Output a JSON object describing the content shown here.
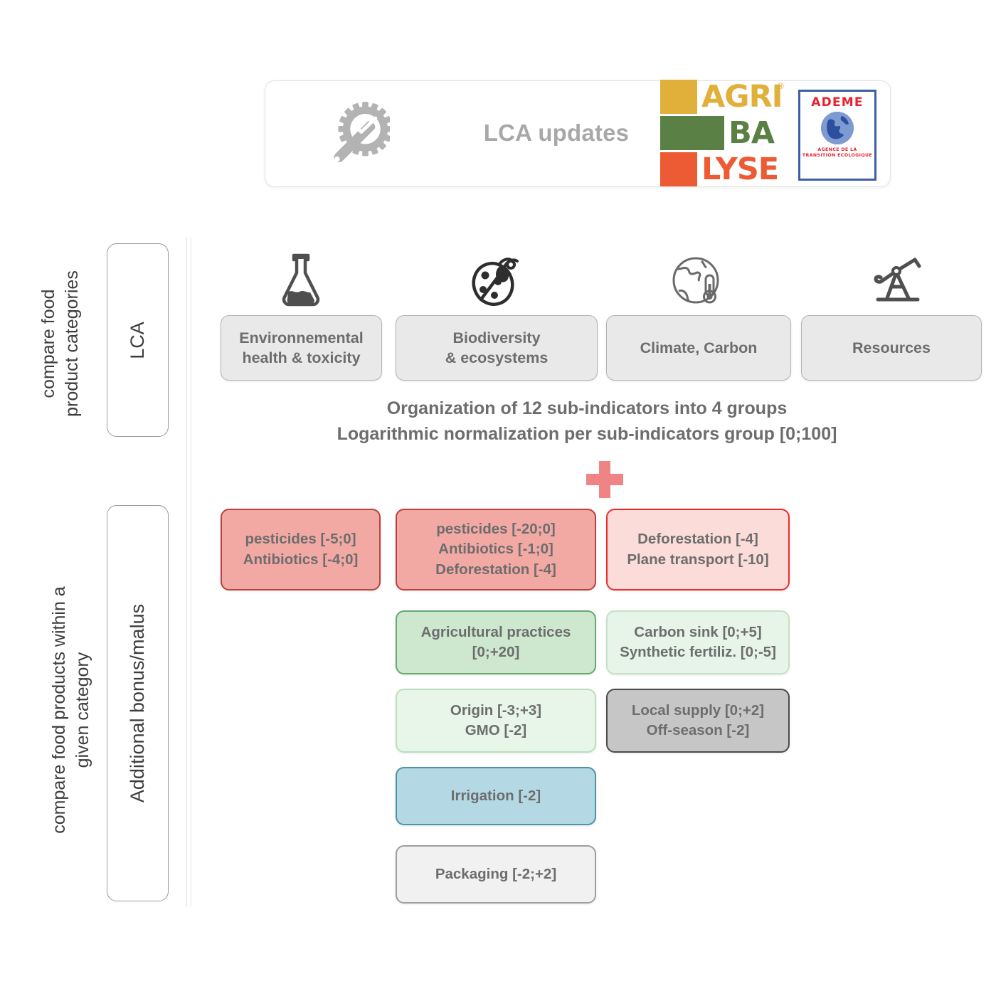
{
  "header": {
    "icon": "gear-wrench-icon",
    "title": "LCA\nupdates",
    "agribalyse": {
      "line1": "AGRI",
      "line2": "BA",
      "line3": "LYSE",
      "registered": "®",
      "color1": "#e0b03a",
      "color2": "#5a8045",
      "color3": "#ec5b33"
    },
    "ademe": {
      "title": "ADEME",
      "subtitle": "AGENCE DE LA\nTRANSITION\nECOLOGIQUE",
      "border_color": "#3d5fa8",
      "text_color": "#e8212e"
    }
  },
  "left_rail": {
    "top_label": "compare food\nproduct categories",
    "bottom_label": "compare food products within a\ngiven category",
    "top_band": "LCA",
    "bottom_band": "Additional bonus/malus"
  },
  "lca_section": {
    "categories": [
      {
        "icon": "flask-icon",
        "label": "Environnemental\nhealth & toxicity"
      },
      {
        "icon": "ladybug-icon",
        "label": "Biodiversity\n& ecosystems"
      },
      {
        "icon": "globe-thermometer-icon",
        "label": "Climate, Carbon"
      },
      {
        "icon": "oil-pump-icon",
        "label": "Resources"
      }
    ],
    "note": "Organization of 12 sub-indicators into 4 groups\nLogarithmic normalization per sub-indicators group [0;100]"
  },
  "plus": {
    "name": "plus-icon",
    "color": "#ee8484"
  },
  "bonus_malus": {
    "boxes": [
      {
        "id": "env-health-red",
        "column": 1,
        "label": "pesticides  [-5;0]\nAntibiotics [-4;0]",
        "fill": "#f2a9a4",
        "border": "#b9413f",
        "text": "#6d6d6d"
      },
      {
        "id": "biodiversity-red",
        "column": 2,
        "label": "pesticides  [-20;0]\nAntibiotics [-1;0]\nDeforestation [-4]",
        "fill": "#f2a9a4",
        "border": "#b9413f",
        "text": "#6d6d6d"
      },
      {
        "id": "climate-red",
        "column": 3,
        "label": "Deforestation [-4]\nPlane transport [-10]",
        "fill": "#fbdcd9",
        "border": "#ef2a2a",
        "text": "#6d6d6d"
      },
      {
        "id": "biodiversity-green",
        "column": 2,
        "label": "Agricultural practices\n[0;+20]",
        "fill": "#cde8cf",
        "border": "#6aa870",
        "text": "#6d6d6d"
      },
      {
        "id": "climate-green",
        "column": 3,
        "label": "Carbon sink [0;+5]\nSynthetic fertiliz. [0;-5]",
        "fill": "#e7f4e8",
        "border": "#c3e2c6",
        "text": "#6d6d6d"
      },
      {
        "id": "biodiversity-origin",
        "column": 2,
        "label": "Origin [-3;+3]\nGMO [-2]",
        "fill": "#e8f5e9",
        "border": "#b9dfbd",
        "text": "#6d6d6d"
      },
      {
        "id": "resources-grey",
        "column": 3,
        "label": "Local supply [0;+2]\nOff-season [-2]",
        "fill": "#c6c6c6",
        "border": "#4b4b4b",
        "text": "#6d6d6d"
      },
      {
        "id": "biodiversity-irrigation",
        "column": 2,
        "label": "Irrigation [-2]",
        "fill": "#b4d9e4",
        "border": "#4e93a7",
        "text": "#6d6d6d"
      },
      {
        "id": "packaging-grey",
        "column": 2,
        "label": "Packaging [-2;+2]",
        "fill": "#f1f1f1",
        "border": "#9f9f9f",
        "text": "#6d6d6d"
      }
    ]
  }
}
